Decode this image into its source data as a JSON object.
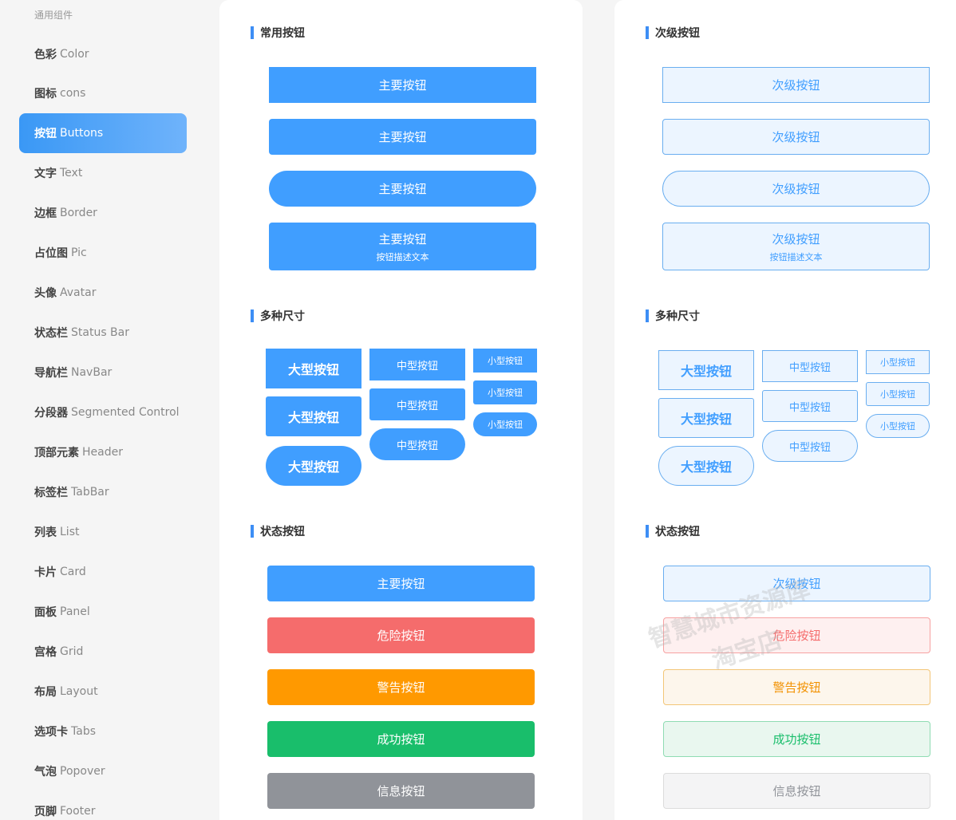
{
  "sidebar": {
    "group_title": "通用组件",
    "items": [
      {
        "cn": "色彩",
        "en": "Color"
      },
      {
        "cn": "图标",
        "en": "cons"
      },
      {
        "cn": "按钮",
        "en": "Buttons"
      },
      {
        "cn": "文字",
        "en": "Text"
      },
      {
        "cn": "边框",
        "en": "Border"
      },
      {
        "cn": "占位图",
        "en": " Pic"
      },
      {
        "cn": "头像",
        "en": "Avatar"
      },
      {
        "cn": "状态栏",
        "en": "Status Bar"
      },
      {
        "cn": "导航栏",
        "en": "NavBar"
      },
      {
        "cn": "分段器",
        "en": "Segmented Control"
      },
      {
        "cn": "顶部元素",
        "en": "Header"
      },
      {
        "cn": "标签栏",
        "en": "TabBar"
      },
      {
        "cn": "列表",
        "en": "List"
      },
      {
        "cn": "卡片",
        "en": "Card"
      },
      {
        "cn": "面板",
        "en": "Panel"
      },
      {
        "cn": "宫格",
        "en": "Grid"
      },
      {
        "cn": "布局",
        "en": "Layout"
      },
      {
        "cn": "选项卡",
        "en": "Tabs"
      },
      {
        "cn": "气泡",
        "en": "Popover"
      },
      {
        "cn": "页脚",
        "en": "Footer"
      }
    ],
    "active_index": 2
  },
  "primary": {
    "common_title": "常用按钮",
    "sizes_title": "多种尺寸",
    "status_title": "状态按钮",
    "btn_label": "主要按钮",
    "btn_desc": "按钮描述文本",
    "large": "大型按钮",
    "medium": "中型按钮",
    "small": "小型按钮",
    "danger": "危险按钮",
    "warning": "警告按钮",
    "success": "成功按钮",
    "info": "信息按钮"
  },
  "secondary": {
    "common_title": "次级按钮",
    "sizes_title": "多种尺寸",
    "status_title": "状态按钮",
    "btn_label": "次级按钮",
    "btn_desc": "按钮描述文本",
    "large": "大型按钮",
    "medium": "中型按钮",
    "small": "小型按钮",
    "danger": "危险按钮",
    "warning": "警告按钮",
    "success": "成功按钮",
    "info": "信息按钮"
  },
  "watermark": {
    "line1": "智慧城市资源库",
    "line2": "淘宝店"
  }
}
